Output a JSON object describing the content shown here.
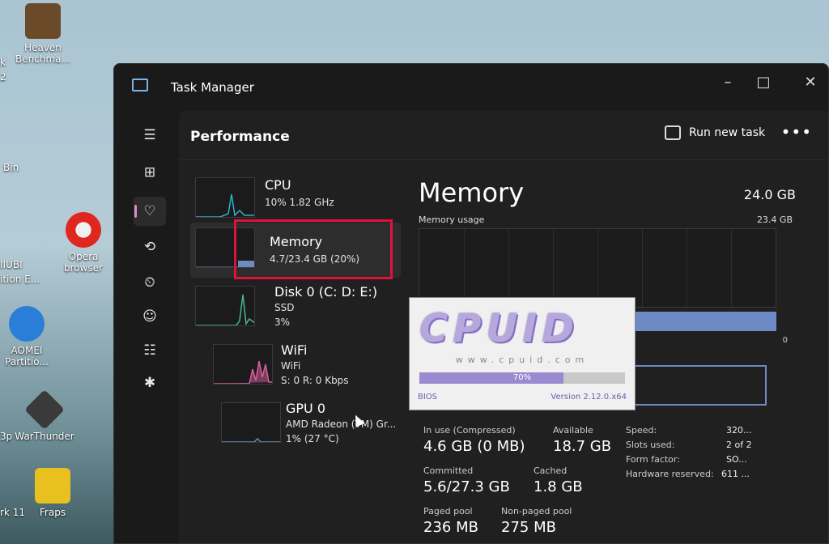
{
  "desktop": {
    "icons": [
      {
        "label_line1": "Heaven",
        "label_line2": "Benchma...",
        "color": "#6b4a2a"
      },
      {
        "label_line1": "Opera",
        "label_line2": "browser",
        "color": "#e0271f"
      },
      {
        "label_line1": "AOMEI",
        "label_line2": "Partitio...",
        "color": "#2a7ed8"
      },
      {
        "label_line1": "WarThunder",
        "label_line2": "",
        "color": "#3a3a3a"
      },
      {
        "label_line1": "Fraps",
        "label_line2": "",
        "color": "#e8c020"
      }
    ],
    "partial_labels": [
      "Bin",
      "IIUBI",
      "ition E...",
      "k",
      "2",
      "3p",
      "rk 11"
    ]
  },
  "window": {
    "title": "Task Manager",
    "minimize": "–",
    "maximize": "□",
    "close": "✕"
  },
  "header": {
    "page_title": "Performance",
    "run_new_task": "Run new task",
    "more": "•••"
  },
  "nav": {
    "icons": [
      "hamburger-icon",
      "processes-icon",
      "performance-icon",
      "app-history-icon",
      "startup-icon",
      "users-icon",
      "details-icon",
      "services-icon"
    ],
    "glyphs": [
      "☰",
      "⊞",
      "♡",
      "⟲",
      "⏲",
      "☺",
      "☷",
      "✱"
    ]
  },
  "sidebar": {
    "items": [
      {
        "name": "CPU",
        "line1": "10%  1.82 GHz",
        "line2": "",
        "graph_color": "#2ab3c9"
      },
      {
        "name": "Memory",
        "line1": "4.7/23.4 GB (20%)",
        "line2": "",
        "graph_color": "#6d8ac4"
      },
      {
        "name": "Disk 0 (C: D: E:)",
        "line1": "SSD",
        "line2": "3%",
        "graph_color": "#4cb88a"
      },
      {
        "name": "WiFi",
        "line1": "WiFi",
        "line2": "S: 0  R: 0 Kbps",
        "graph_color": "#d95fa0"
      },
      {
        "name": "GPU 0",
        "line1": "AMD Radeon (TM) Gr...",
        "line2": "1% (27 °C)",
        "graph_color": "#6d8ac4"
      }
    ]
  },
  "main": {
    "title": "Memory",
    "total": "24.0 GB",
    "usage_label": "Memory usage",
    "usage_max": "23.4 GB",
    "zero_label": "0",
    "stats": {
      "in_use_label": "In use (Compressed)",
      "in_use_value": "4.6 GB (0 MB)",
      "available_label": "Available",
      "available_value": "18.7 GB",
      "committed_label": "Committed",
      "committed_value": "5.6/27.3 GB",
      "cached_label": "Cached",
      "cached_value": "1.8 GB",
      "paged_label": "Paged pool",
      "paged_value": "236 MB",
      "nonpaged_label": "Non-paged pool",
      "nonpaged_value": "275 MB"
    },
    "details": [
      {
        "label": "Speed:",
        "value": "320..."
      },
      {
        "label": "Slots used:",
        "value": "2 of 2"
      },
      {
        "label": "Form factor:",
        "value": "SO..."
      },
      {
        "label": "Hardware reserved:",
        "value": "611 ..."
      }
    ]
  },
  "cpuid_splash": {
    "logo": "CPUID",
    "url": "www.cpuid.com",
    "progress": 0.7,
    "progress_label": "70%",
    "bios": "BIOS",
    "version": "Version 2.12.0.x64"
  }
}
